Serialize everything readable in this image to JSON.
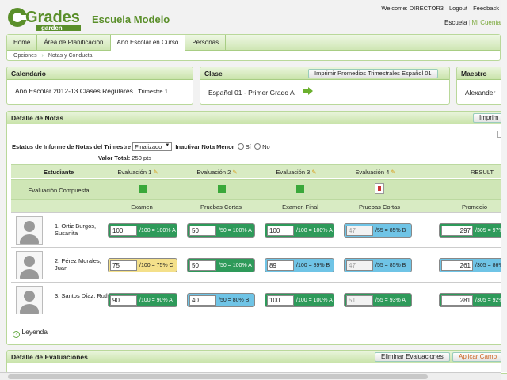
{
  "header": {
    "logo_text": "Grades",
    "logo_sub": "garden",
    "school": "Escuela Modelo",
    "welcome": "Welcome: DIRECTOR3",
    "logout": "Logout",
    "feedback": "Feedback",
    "escuela": "Escuela",
    "sep": "|",
    "mi_cuenta": "Mi Cuenta"
  },
  "nav": {
    "tabs": [
      "Home",
      "Área de Planificación",
      "Año Escolar en Curso",
      "Personas"
    ],
    "breadcrumb": [
      "Opciones",
      "›",
      "Notas y Conducta"
    ]
  },
  "calendar": {
    "title": "Calendario",
    "text": "Año Escolar 2012-13  Clases Regulares",
    "term": "Trimestre 1"
  },
  "clase": {
    "title": "Clase",
    "print_button": "Imprimir Promedios Trimestrales Español 01",
    "text": "Español 01 -  Primer Grado  A"
  },
  "maestro": {
    "title": "Maestro",
    "text": "Alexander"
  },
  "detalle": {
    "title": "Detalle de Notas",
    "print_button": "Imprim",
    "status_label": "Estatus de Informe de Notas del Trimestre",
    "status_value": "Finalizado",
    "inactivar_label": "Inactivar Nota Menor",
    "si": "Sí",
    "no": "No",
    "valor_total_label": "Valor Total:",
    "valor_total": "250 pts",
    "col_estudiante": "Estudiante",
    "evaluaciones": [
      "Evaluación 1",
      "Evaluación 2",
      "Evaluación 3",
      "Evaluación 4"
    ],
    "resultado": "RESULT",
    "compuesta": "Evaluación Compuesta",
    "subheads": [
      "Examen",
      "Pruebas Cortas",
      "Examen Final",
      "Pruebas Cortas",
      "Promedio"
    ],
    "leyenda": "Leyenda"
  },
  "students": [
    {
      "name": "1. Ortiz Burgos, Susanita",
      "scores": [
        {
          "value": "100",
          "text": "/100 = 100% A",
          "color": "green"
        },
        {
          "value": "50",
          "text": "/50 = 100% A",
          "color": "green"
        },
        {
          "value": "100",
          "text": "/100 = 100% A",
          "color": "green"
        },
        {
          "value": "47",
          "text": "/55 = 85% B",
          "color": "blue"
        }
      ],
      "avg_value": "297",
      "avg_text": "/305 = 97%"
    },
    {
      "name": "2. Pérez Morales, Juan",
      "scores": [
        {
          "value": "75",
          "text": "/100 = 75% C",
          "color": "yellow"
        },
        {
          "value": "50",
          "text": "/50 = 100% A",
          "color": "green"
        },
        {
          "value": "89",
          "text": "/100 = 89% B",
          "color": "blue"
        },
        {
          "value": "47",
          "text": "/55 = 85% B",
          "color": "blue"
        }
      ],
      "avg_value": "261",
      "avg_text": "/305 = 86%"
    },
    {
      "name": "3. Santos Díaz, Ruth",
      "scores": [
        {
          "value": "90",
          "text": "/100 = 90% A",
          "color": "green"
        },
        {
          "value": "40",
          "text": "/50 = 80% B",
          "color": "blue"
        },
        {
          "value": "100",
          "text": "/100 = 100% A",
          "color": "green"
        },
        {
          "value": "51",
          "text": "/55 = 93% A",
          "color": "green"
        }
      ],
      "avg_value": "281",
      "avg_text": "/305 = 92%"
    }
  ],
  "evaluaciones_panel": {
    "title": "Detalle de Evaluaciones",
    "eliminar": "Eliminar Evaluaciones",
    "aplicar": "Aplicar Camb"
  },
  "colors": {
    "accent": "#5a8f2a",
    "green": "#2e9a5a",
    "blue": "#6fc4e6",
    "yellow": "#f4e08a"
  }
}
